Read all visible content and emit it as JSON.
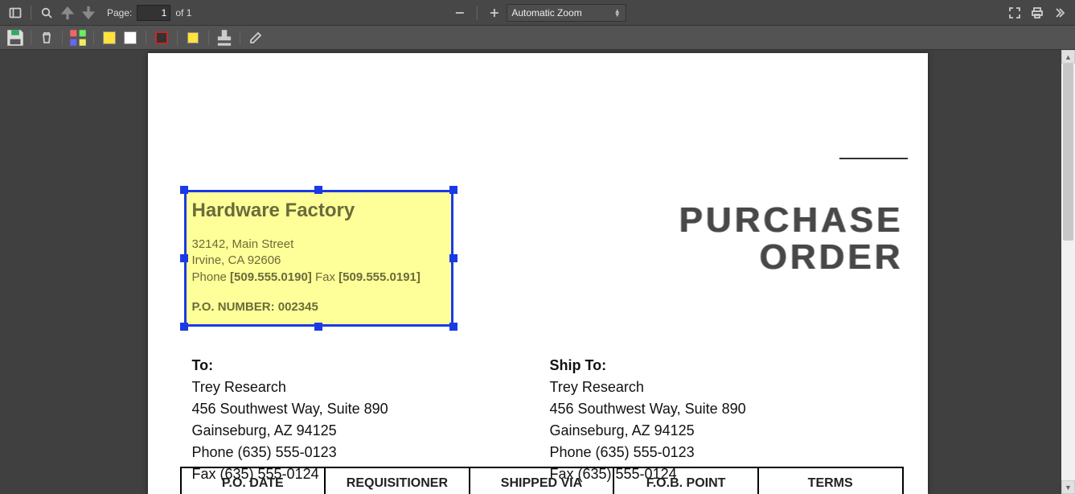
{
  "toolbar": {
    "page_label": "Page:",
    "page_current": "1",
    "page_of": "of 1",
    "zoom_mode": "Automatic Zoom"
  },
  "icons": {
    "sidebar": "sidebar-icon",
    "search": "search-icon",
    "prev": "arrow-up-icon",
    "next": "arrow-down-icon",
    "zoom_out": "minus-icon",
    "zoom_in": "plus-icon",
    "fullscreen": "fullscreen-icon",
    "print": "print-icon",
    "more": "chevrons-right-icon",
    "save": "save-icon",
    "trash": "trash-icon",
    "grid": "grid-icon",
    "highlight_yellow": "highlight-yellow",
    "highlight_white": "highlight-white",
    "shape": "shape-tool",
    "note": "note-tool",
    "stamp": "stamp-tool",
    "draw": "pencil-icon"
  },
  "doc": {
    "vendor": {
      "name": "Hardware Factory",
      "addr1": "32142, Main Street",
      "addr2": "Irvine, CA 92606",
      "phone_lbl": "Phone ",
      "phone": "[509.555.0190]",
      "fax_lbl": "  Fax ",
      "fax": "[509.555.0191]",
      "po_lbl": "P.O. NUMBER: ",
      "po_num": "002345"
    },
    "title1": "PURCHASE",
    "title2": "ORDER",
    "to": {
      "hdr": "To:",
      "l1": "Trey Research",
      "l2": "456 Southwest Way, Suite 890",
      "l3": "Gainseburg, AZ 94125",
      "l4": "Phone (635) 555-0123",
      "l5": "Fax (635) 555-0124"
    },
    "ship": {
      "hdr": "Ship To:",
      "l1": "Trey Research",
      "l2": "456 Southwest Way, Suite 890",
      "l3": "Gainseburg, AZ 94125",
      "l4": "Phone (635) 555-0123",
      "l5": "Fax (635) 555-0124"
    },
    "table": {
      "c1": "P.O. DATE",
      "c2": "REQUISITIONER",
      "c3": "SHIPPED VIA",
      "c4": "F.O.B. POINT",
      "c5": "TERMS"
    }
  }
}
